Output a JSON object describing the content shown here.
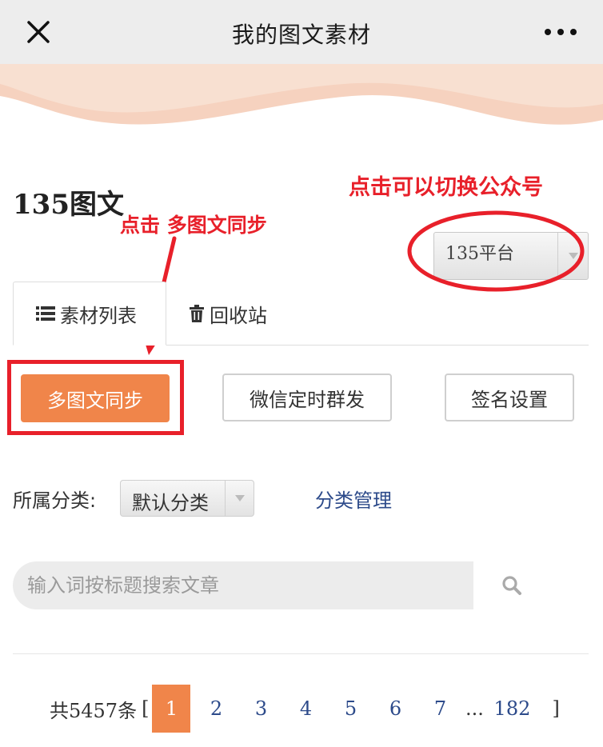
{
  "topbar": {
    "title": "我的图文素材",
    "close_icon": "close-icon",
    "more_icon": "more-dots-icon"
  },
  "header": {
    "app_name": "135图文"
  },
  "annotations": {
    "switch_hint": "点击可以切换公众号",
    "sync_hint": "点击 多图文同步"
  },
  "account_select": {
    "value": "135平台"
  },
  "tabs": [
    {
      "label": "素材列表",
      "icon": "list-icon",
      "active": true
    },
    {
      "label": "回收站",
      "icon": "trash-icon",
      "active": false
    }
  ],
  "actions": {
    "sync_label": "多图文同步",
    "schedule_label": "微信定时群发",
    "signature_label": "签名设置"
  },
  "category": {
    "label": "所属分类:",
    "selected": "默认分类",
    "manage_label": "分类管理"
  },
  "search": {
    "placeholder": "输入词按标题搜索文章",
    "icon": "search-icon"
  },
  "pagination": {
    "total_text": "共5457条",
    "open_bracket": "[",
    "close_bracket": "]",
    "current": "1",
    "pages": [
      "2",
      "3",
      "4",
      "5",
      "6",
      "7"
    ],
    "ellipsis": "...",
    "last": "182"
  },
  "colors": {
    "accent_orange": "#f0854a",
    "annotation_red": "#e8202a",
    "link_blue": "#2c4a8a",
    "topbar_bg": "#ededed"
  }
}
